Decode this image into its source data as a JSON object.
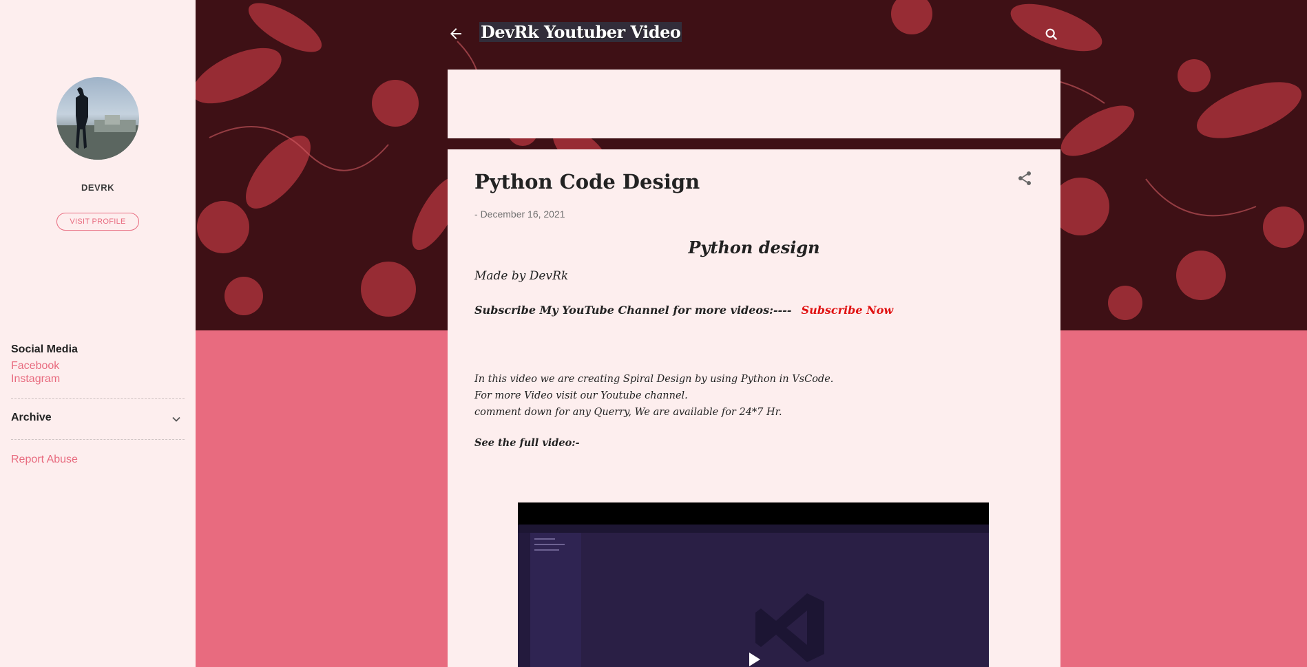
{
  "header": {
    "blog_title": "DevRk Youtuber Video"
  },
  "sidebar": {
    "profile_name": "DEVRK",
    "visit_profile_label": "VISIT PROFILE",
    "social_title": "Social Media",
    "social_links": [
      "Facebook",
      "Instagram"
    ],
    "archive_title": "Archive",
    "report_abuse": "Report Abuse"
  },
  "post": {
    "title": "Python Code Design",
    "date_prefix": "- ",
    "date": "December 16, 2021",
    "heading": "Python design",
    "made_by": "Made by DevRk",
    "subscribe_text": "Subscribe My YouTube Channel for more videos:----",
    "subscribe_link": "Subscribe Now",
    "description": [
      "In this video we are creating Spiral Design by using Python in VsCode.",
      "For more Video visit our Youtube channel.",
      "comment down for any Querry, We are available for 24*7 Hr."
    ],
    "see_full": "See the full video:-"
  },
  "colors": {
    "accent": "#e86b7f",
    "header_bg": "#3e1015",
    "card_bg": "#fdeeee",
    "link_red": "#e01111"
  },
  "icons": {
    "back": "arrow-back-icon",
    "search": "search-icon",
    "share": "share-icon",
    "archive_toggle": "chevron-down-icon",
    "video_play": "play-icon"
  }
}
